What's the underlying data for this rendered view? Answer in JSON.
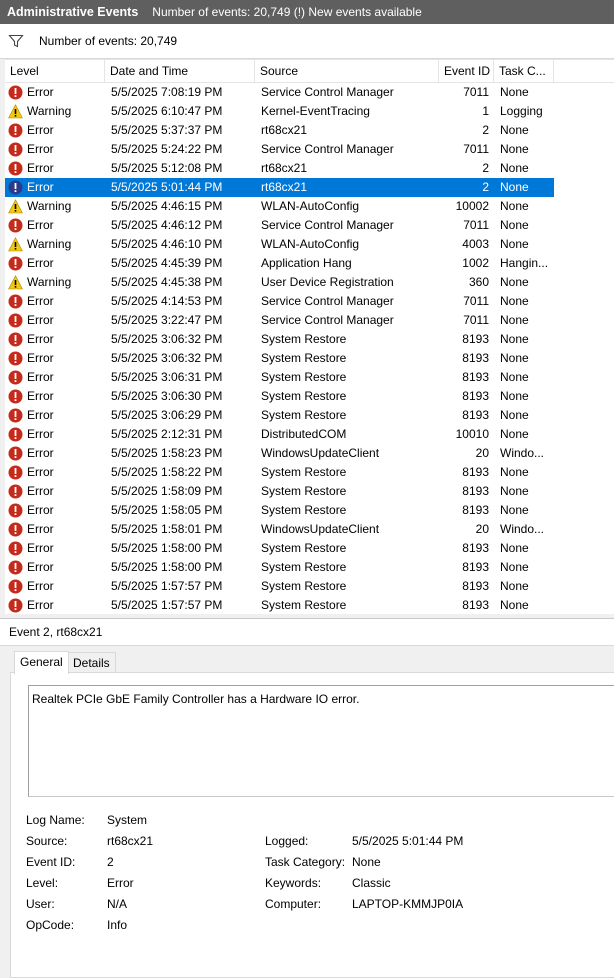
{
  "title": {
    "name": "Administrative Events",
    "info": "Number of events: 20,749 (!) New events available"
  },
  "filter": {
    "icon": "filter-icon",
    "text": "Number of events: 20,749"
  },
  "columns": [
    "Level",
    "Date and Time",
    "Source",
    "Event ID",
    "Task C..."
  ],
  "colors": {
    "selection": "#0078d7",
    "error": "#c42b1c",
    "warning": "#f2c811",
    "titlebar": "#5f5f5f"
  },
  "events": [
    {
      "level": "Error",
      "icon": "error-icon",
      "date": "5/5/2025 7:08:19 PM",
      "source": "Service Control Manager",
      "id": "7011",
      "task": "None"
    },
    {
      "level": "Warning",
      "icon": "warning-icon",
      "date": "5/5/2025 6:10:47 PM",
      "source": "Kernel-EventTracing",
      "id": "1",
      "task": "Logging"
    },
    {
      "level": "Error",
      "icon": "error-icon",
      "date": "5/5/2025 5:37:37 PM",
      "source": "rt68cx21",
      "id": "2",
      "task": "None"
    },
    {
      "level": "Error",
      "icon": "error-icon",
      "date": "5/5/2025 5:24:22 PM",
      "source": "Service Control Manager",
      "id": "7011",
      "task": "None"
    },
    {
      "level": "Error",
      "icon": "error-icon",
      "date": "5/5/2025 5:12:08 PM",
      "source": "rt68cx21",
      "id": "2",
      "task": "None"
    },
    {
      "level": "Error",
      "icon": "error-icon",
      "date": "5/5/2025 5:01:44 PM",
      "source": "rt68cx21",
      "id": "2",
      "task": "None",
      "selected": true
    },
    {
      "level": "Warning",
      "icon": "warning-icon",
      "date": "5/5/2025 4:46:15 PM",
      "source": "WLAN-AutoConfig",
      "id": "10002",
      "task": "None"
    },
    {
      "level": "Error",
      "icon": "error-icon",
      "date": "5/5/2025 4:46:12 PM",
      "source": "Service Control Manager",
      "id": "7011",
      "task": "None"
    },
    {
      "level": "Warning",
      "icon": "warning-icon",
      "date": "5/5/2025 4:46:10 PM",
      "source": "WLAN-AutoConfig",
      "id": "4003",
      "task": "None"
    },
    {
      "level": "Error",
      "icon": "error-icon",
      "date": "5/5/2025 4:45:39 PM",
      "source": "Application Hang",
      "id": "1002",
      "task": "Hangin..."
    },
    {
      "level": "Warning",
      "icon": "warning-icon",
      "date": "5/5/2025 4:45:38 PM",
      "source": "User Device Registration",
      "id": "360",
      "task": "None"
    },
    {
      "level": "Error",
      "icon": "error-icon",
      "date": "5/5/2025 4:14:53 PM",
      "source": "Service Control Manager",
      "id": "7011",
      "task": "None"
    },
    {
      "level": "Error",
      "icon": "error-icon",
      "date": "5/5/2025 3:22:47 PM",
      "source": "Service Control Manager",
      "id": "7011",
      "task": "None"
    },
    {
      "level": "Error",
      "icon": "error-icon",
      "date": "5/5/2025 3:06:32 PM",
      "source": "System Restore",
      "id": "8193",
      "task": "None"
    },
    {
      "level": "Error",
      "icon": "error-icon",
      "date": "5/5/2025 3:06:32 PM",
      "source": "System Restore",
      "id": "8193",
      "task": "None"
    },
    {
      "level": "Error",
      "icon": "error-icon",
      "date": "5/5/2025 3:06:31 PM",
      "source": "System Restore",
      "id": "8193",
      "task": "None"
    },
    {
      "level": "Error",
      "icon": "error-icon",
      "date": "5/5/2025 3:06:30 PM",
      "source": "System Restore",
      "id": "8193",
      "task": "None"
    },
    {
      "level": "Error",
      "icon": "error-icon",
      "date": "5/5/2025 3:06:29 PM",
      "source": "System Restore",
      "id": "8193",
      "task": "None"
    },
    {
      "level": "Error",
      "icon": "error-icon",
      "date": "5/5/2025 2:12:31 PM",
      "source": "DistributedCOM",
      "id": "10010",
      "task": "None"
    },
    {
      "level": "Error",
      "icon": "error-icon",
      "date": "5/5/2025 1:58:23 PM",
      "source": "WindowsUpdateClient",
      "id": "20",
      "task": "Windo..."
    },
    {
      "level": "Error",
      "icon": "error-icon",
      "date": "5/5/2025 1:58:22 PM",
      "source": "System Restore",
      "id": "8193",
      "task": "None"
    },
    {
      "level": "Error",
      "icon": "error-icon",
      "date": "5/5/2025 1:58:09 PM",
      "source": "System Restore",
      "id": "8193",
      "task": "None"
    },
    {
      "level": "Error",
      "icon": "error-icon",
      "date": "5/5/2025 1:58:05 PM",
      "source": "System Restore",
      "id": "8193",
      "task": "None"
    },
    {
      "level": "Error",
      "icon": "error-icon",
      "date": "5/5/2025 1:58:01 PM",
      "source": "WindowsUpdateClient",
      "id": "20",
      "task": "Windo..."
    },
    {
      "level": "Error",
      "icon": "error-icon",
      "date": "5/5/2025 1:58:00 PM",
      "source": "System Restore",
      "id": "8193",
      "task": "None"
    },
    {
      "level": "Error",
      "icon": "error-icon",
      "date": "5/5/2025 1:58:00 PM",
      "source": "System Restore",
      "id": "8193",
      "task": "None"
    },
    {
      "level": "Error",
      "icon": "error-icon",
      "date": "5/5/2025 1:57:57 PM",
      "source": "System Restore",
      "id": "8193",
      "task": "None"
    },
    {
      "level": "Error",
      "icon": "error-icon",
      "date": "5/5/2025 1:57:57 PM",
      "source": "System Restore",
      "id": "8193",
      "task": "None"
    }
  ],
  "detail": {
    "title": "Event 2, rt68cx21",
    "tabs": [
      "General",
      "Details"
    ],
    "description": "Realtek PCIe GbE Family Controller has a Hardware IO error.",
    "props": {
      "log_name_label": "Log Name:",
      "log_name": "System",
      "source_label": "Source:",
      "source": "rt68cx21",
      "logged_label": "Logged:",
      "logged": "5/5/2025 5:01:44 PM",
      "event_id_label": "Event ID:",
      "event_id": "2",
      "task_category_label": "Task Category:",
      "task_category": "None",
      "level_label": "Level:",
      "level": "Error",
      "keywords_label": "Keywords:",
      "keywords": "Classic",
      "user_label": "User:",
      "user": "N/A",
      "computer_label": "Computer:",
      "computer": "LAPTOP-KMMJP0IA",
      "opcode_label": "OpCode:",
      "opcode": "Info"
    }
  }
}
